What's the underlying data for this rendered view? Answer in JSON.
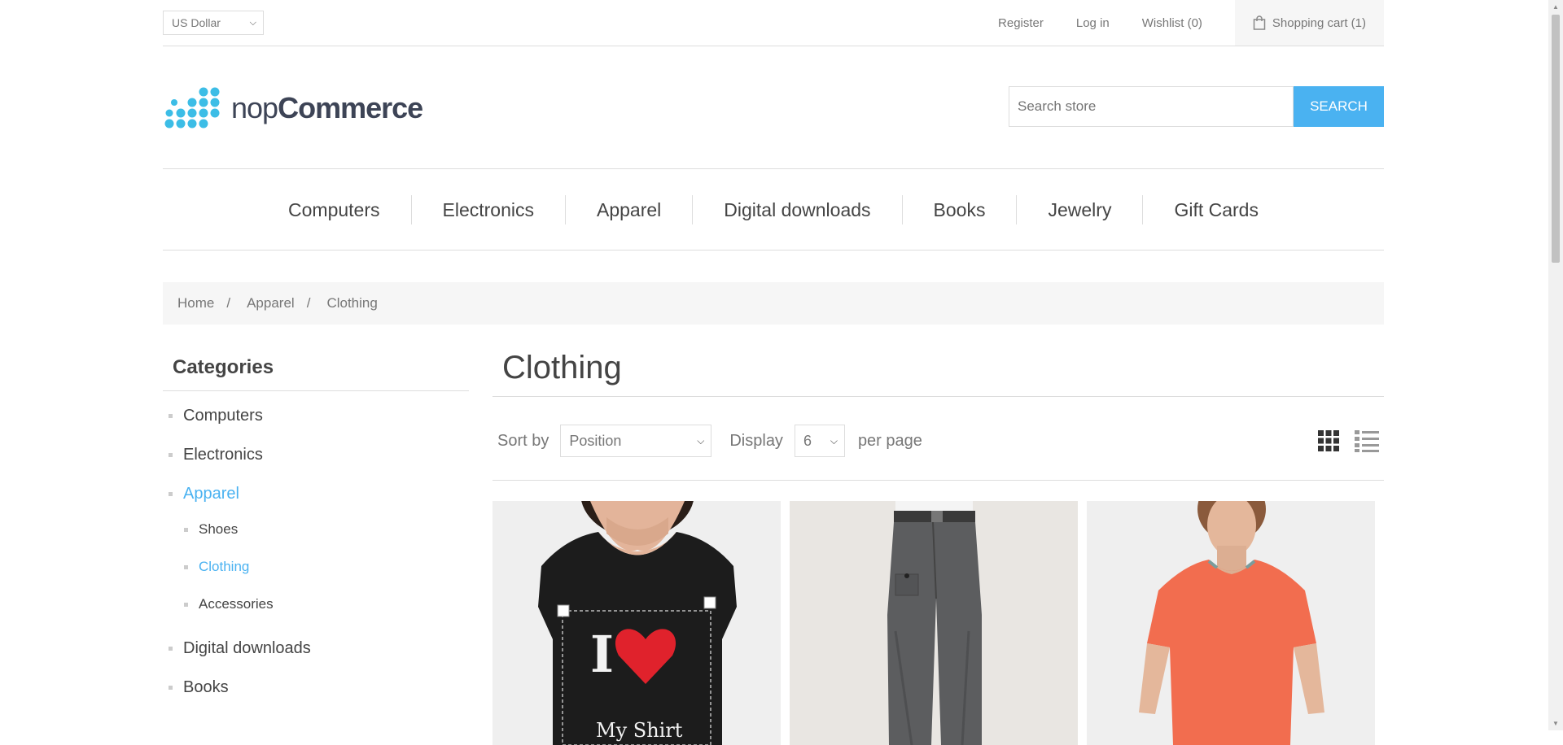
{
  "currency": {
    "selected": "US Dollar"
  },
  "header_links": {
    "register": "Register",
    "login": "Log in",
    "wishlist": "Wishlist (0)",
    "cart": "Shopping cart (1)"
  },
  "logo": {
    "part1": "nop",
    "part2": "Commerce"
  },
  "search": {
    "placeholder": "Search store",
    "button": "SEARCH"
  },
  "top_menu": [
    "Computers",
    "Electronics",
    "Apparel",
    "Digital downloads",
    "Books",
    "Jewelry",
    "Gift Cards"
  ],
  "breadcrumb": {
    "home": "Home",
    "sep": "/",
    "parent": "Apparel",
    "current": "Clothing"
  },
  "side": {
    "title": "Categories",
    "categories": [
      "Computers",
      "Electronics",
      "Apparel",
      "Digital downloads",
      "Books"
    ],
    "subcategories": [
      "Shoes",
      "Clothing",
      "Accessories"
    ]
  },
  "page": {
    "title": "Clothing",
    "sort_label": "Sort by",
    "sort_value": "Position",
    "display_label": "Display",
    "display_value": "6",
    "per_page": "per page"
  },
  "products": [
    {
      "image": "black-tshirt-i-love-my-shirt",
      "shirt_text": "My Shirt"
    },
    {
      "image": "grey-trousers"
    },
    {
      "image": "orange-tshirt"
    }
  ],
  "colors": {
    "accent": "#4ab2f1",
    "logo_dots": "#3cbde6"
  }
}
